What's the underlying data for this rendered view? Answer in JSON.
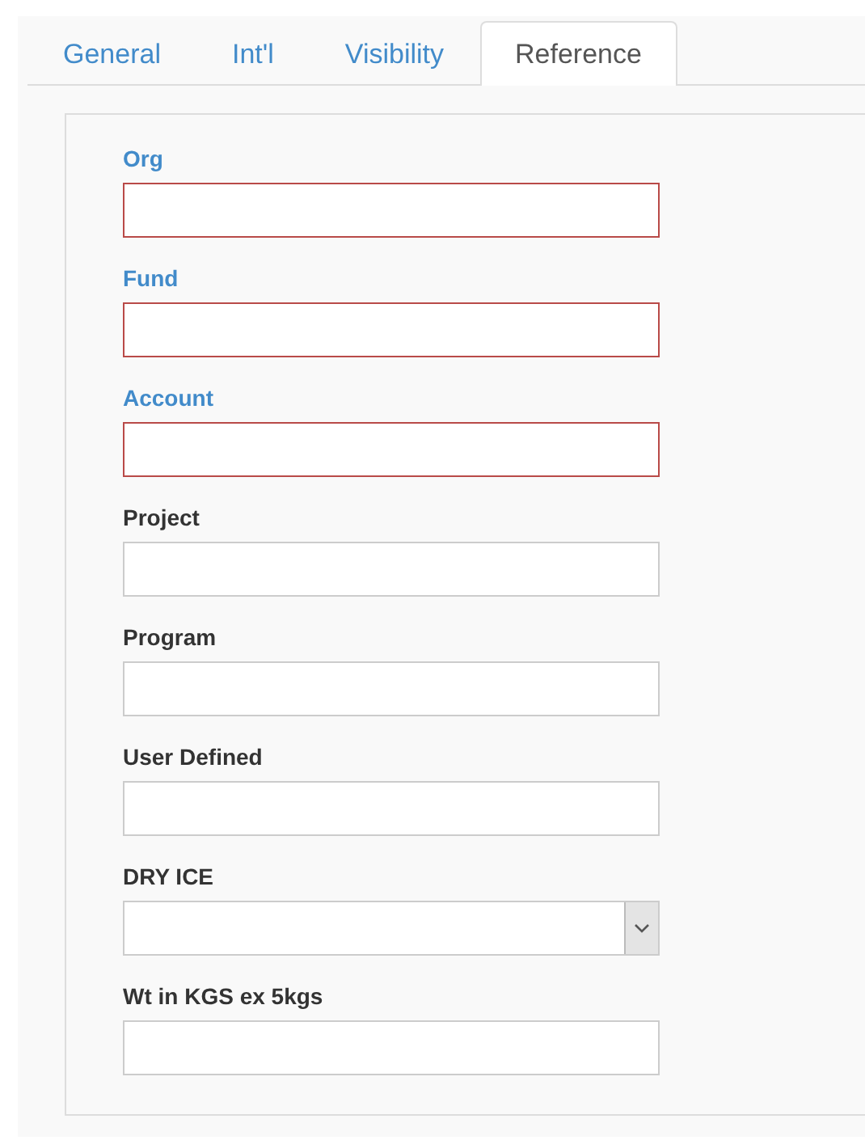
{
  "tabs": [
    {
      "label": "General",
      "selected": false
    },
    {
      "label": "Int'l",
      "selected": false
    },
    {
      "label": "Visibility",
      "selected": false
    },
    {
      "label": "Reference",
      "selected": true
    }
  ],
  "fields": [
    {
      "label": "Org",
      "kind": "text",
      "required": true
    },
    {
      "label": "Fund",
      "kind": "text",
      "required": true
    },
    {
      "label": "Account",
      "kind": "text",
      "required": true
    },
    {
      "label": "Project",
      "kind": "text",
      "required": false
    },
    {
      "label": "Program",
      "kind": "text",
      "required": false
    },
    {
      "label": "User Defined",
      "kind": "text",
      "required": false
    },
    {
      "label": "DRY ICE",
      "kind": "select",
      "required": false
    },
    {
      "label": "Wt in KGS ex 5kgs",
      "kind": "text",
      "required": false
    }
  ]
}
